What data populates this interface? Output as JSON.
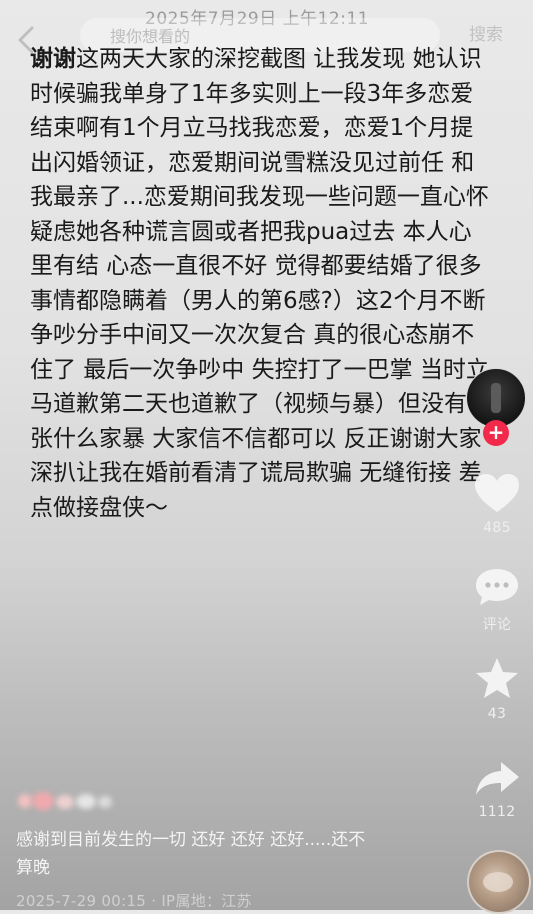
{
  "status": {
    "timestamp": "2025年7月29日 上午12:11"
  },
  "header": {
    "search_placeholder": "搜你想看的",
    "search_button": "搜索"
  },
  "note": {
    "lead": "谢谢",
    "lines": [
      "这两天大家的深挖截图 让我发现 她认识",
      "时候骗我单身了1年多实则上一段3年多恋爱",
      "结束啊有1个月立马找我恋爱，恋爱1个月提",
      "出闪婚领证，恋爱期间说雪糕没见过前任 和",
      "我最亲了...恋爱期间我发现一些问题一直心怀",
      "疑虑她各种谎言圆或者把我pua过去 本人心",
      "里有结 心态一直很不好 觉得都要结婚了很多",
      "事情都隐瞒着（男人的第6感?）这2个月不断",
      "争吵分手中间又一次次复合 真的很心态崩不",
      "住了 最后一次争吵中 失控打了一巴掌 当时立",
      "马道歉第二天也道歉了（视频与暴）但没有夸",
      "张什么家暴 大家信不信都可以 反正谢谢大家",
      "深扒让我在婚前看清了谎局欺骗 无缝衔接 差",
      "点做接盘侠～"
    ]
  },
  "side_rail": {
    "follow_symbol": "+",
    "like_count": "485",
    "comment_label": "评论",
    "star_count": "43",
    "share_count": "1112"
  },
  "post": {
    "caption_line1": "感谢到目前发生的一切 还好 还好 还好.....还不",
    "caption_line2": "算晚",
    "meta": "2025-7-29 00:15 · IP属地：江苏"
  },
  "icons": {
    "back": "chevron-left-icon",
    "like": "heart-icon",
    "comment": "speech-bubble-icon",
    "star": "star-icon",
    "share": "share-arrow-icon"
  },
  "colors": {
    "follow_red": "#f2294a",
    "note_text": "#1a1a1a",
    "overlay_text": "#f4f4f4"
  }
}
